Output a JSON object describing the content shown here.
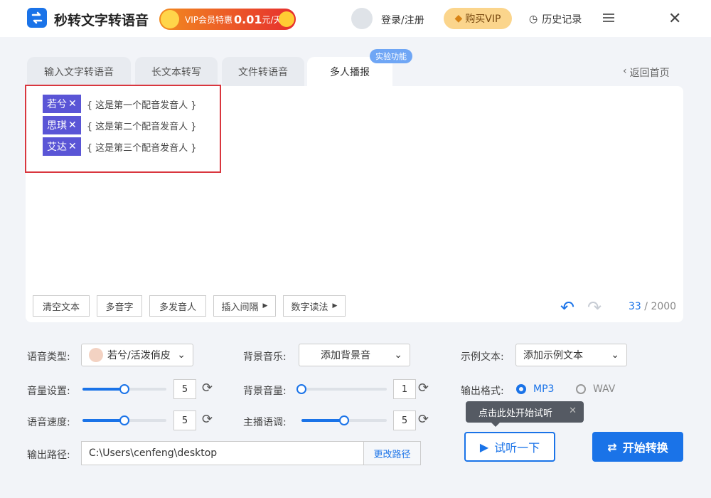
{
  "header": {
    "app_title": "秒转文字转语音",
    "vip_promo": {
      "prefix": "VIP会员特惠",
      "price": "0.01",
      "unit": "元/天"
    },
    "login": "登录/注册",
    "buy_vip": "购买VIP",
    "history": "历史记录"
  },
  "tabs": [
    "输入文字转语音",
    "长文本转写",
    "文件转语音",
    "多人播报"
  ],
  "experimental_badge": "实验功能",
  "back_home": "返回首页",
  "speakers": [
    {
      "name": "若兮",
      "desc": "这是第一个配音发音人"
    },
    {
      "name": "思琪",
      "desc": "这是第二个配音发音人"
    },
    {
      "name": "艾达",
      "desc": "这是第三个配音发音人"
    }
  ],
  "toolbar": {
    "clear": "清空文本",
    "polyphone": "多音字",
    "multi_speaker": "多发音人",
    "insert_pause": "插入间隔",
    "number_reading": "数字读法"
  },
  "counter": {
    "current": "33",
    "max": "/ 2000"
  },
  "settings": {
    "voice_type_label": "语音类型:",
    "voice_type_value": "若兮/活泼俏皮",
    "bg_music_label": "背景音乐:",
    "bg_music_value": "添加背景音",
    "sample_text_label": "示例文本:",
    "sample_text_value": "添加示例文本",
    "volume_label": "音量设置:",
    "volume_value": "5",
    "bg_volume_label": "背景音量:",
    "bg_volume_value": "1",
    "output_format_label": "输出格式:",
    "format_mp3": "MP3",
    "format_wav": "WAV",
    "speed_label": "语音速度:",
    "speed_value": "5",
    "pitch_label": "主播语调:",
    "pitch_value": "5",
    "output_path_label": "输出路径:",
    "output_path_value": "C:\\Users\\cenfeng\\desktop",
    "change_path": "更改路径"
  },
  "sliders": {
    "volume": 0.5,
    "bg_volume": 0.0,
    "speed": 0.5,
    "pitch": 0.5
  },
  "tooltip": "点击此处开始试听",
  "preview_button": "试听一下",
  "convert_button": "开始转换",
  "colors": {
    "accent": "#1a73e8",
    "speaker_tag": "#5a55d6",
    "highlight_box": "#d9363e"
  }
}
